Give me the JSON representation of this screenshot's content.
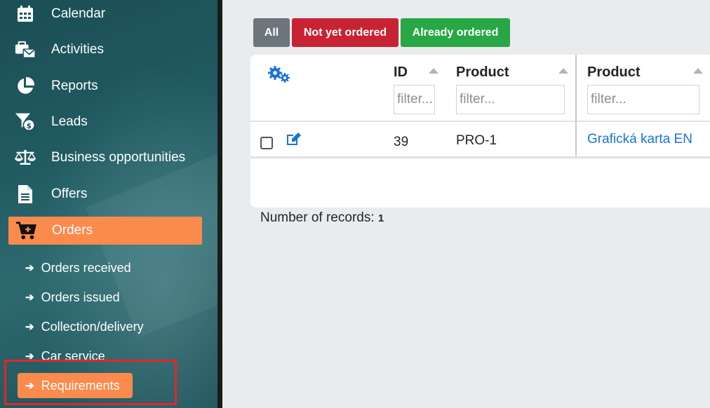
{
  "sidebar": {
    "items": [
      {
        "label": "Calendar",
        "icon": "calendar-icon"
      },
      {
        "label": "Activities",
        "icon": "activities-icon"
      },
      {
        "label": "Reports",
        "icon": "pie-chart-icon"
      },
      {
        "label": "Leads",
        "icon": "funnel-dollar-icon"
      },
      {
        "label": "Business opportunities",
        "icon": "balance-scale-icon"
      },
      {
        "label": "Offers",
        "icon": "document-icon"
      },
      {
        "label": "Orders",
        "icon": "cart-icon",
        "active": true
      }
    ],
    "subitems": [
      {
        "label": "Orders received"
      },
      {
        "label": "Orders issued"
      },
      {
        "label": "Collection/delivery"
      },
      {
        "label": "Car service"
      },
      {
        "label": "Requirements",
        "active": true
      }
    ]
  },
  "filters": {
    "all": "All",
    "not_ordered": "Not yet ordered",
    "already_ordered": "Already ordered"
  },
  "table": {
    "columns": [
      {
        "label": "ID",
        "placeholder": "filter..."
      },
      {
        "label": "Product",
        "placeholder": "filter..."
      },
      {
        "label": "Product",
        "placeholder": "filter..."
      }
    ],
    "rows": [
      {
        "id": "39",
        "product_code": "PRO-1",
        "product_name": "Grafická karta EN"
      }
    ]
  },
  "footer": {
    "records_label": "Number of records:",
    "records_count": "1"
  },
  "colors": {
    "accent": "#fb8a4d",
    "danger": "#c82333",
    "success": "#28a745",
    "secondary": "#6c757d",
    "link": "#1a73d9"
  }
}
